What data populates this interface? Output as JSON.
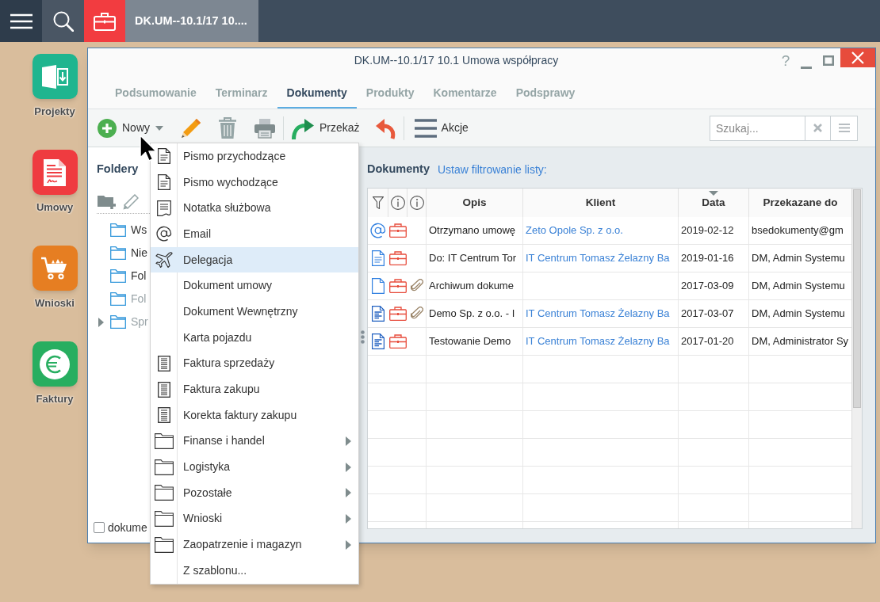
{
  "top_bar": {
    "tabs": [
      {
        "title": "DK.UM--10.1/17 10....",
        "selected": true
      }
    ]
  },
  "desktop_icons": [
    {
      "label": "Projekty",
      "kind": "project",
      "color": "#1fb58f"
    },
    {
      "label": "Umowy",
      "kind": "contract",
      "color": "#ef3b40"
    },
    {
      "label": "Wnioski",
      "kind": "cart",
      "color": "#e67e22"
    },
    {
      "label": "Faktury",
      "kind": "euro",
      "color": "#27ae60"
    }
  ],
  "window": {
    "title": "DK.UM--10.1/17 10.1 Umowa współpracy",
    "help": "?",
    "tabs": [
      {
        "label": "Podsumowanie",
        "selected": false
      },
      {
        "label": "Terminarz",
        "selected": false
      },
      {
        "label": "Dokumenty",
        "selected": true
      },
      {
        "label": "Produkty",
        "selected": false
      },
      {
        "label": "Komentarze",
        "selected": false
      },
      {
        "label": "Podsprawy",
        "selected": false
      }
    ],
    "toolbar": {
      "groups": [
        {
          "buttons": [
            {
              "kind": "new",
              "label": "Nowy"
            },
            {
              "kind": "edit"
            },
            {
              "kind": "delete"
            },
            {
              "kind": "print"
            }
          ]
        },
        {
          "buttons": [
            {
              "kind": "forward",
              "label": "Przekaż"
            },
            {
              "kind": "undo"
            }
          ]
        },
        {
          "buttons": [
            {
              "kind": "actions",
              "label": "Akcje"
            }
          ]
        }
      ]
    },
    "search": {
      "placeholder": "Szukaj..."
    },
    "folders": {
      "title": "Foldery",
      "tree": [
        {
          "label": "Ws",
          "muted": false,
          "collapsed": false
        },
        {
          "label": "Nie",
          "muted": false,
          "collapsed": false
        },
        {
          "label": "Fol",
          "muted": false,
          "collapsed": false
        },
        {
          "label": "Fol",
          "muted": true,
          "collapsed": false
        },
        {
          "label": "Spr",
          "muted": true,
          "collapsed": true
        }
      ],
      "checkbox": {
        "label": "dokume",
        "checked": false
      }
    },
    "documents": {
      "title": "Dokumenty",
      "filter_link": "Ustaw filtrowanie listy:",
      "columns": [
        {
          "kind": "filter",
          "sorted": false
        },
        {
          "kind": "info",
          "sorted": false
        },
        {
          "kind": "info",
          "sorted": false
        },
        {
          "kind": "text",
          "label": "Opis",
          "sorted": false
        },
        {
          "kind": "text",
          "label": "Klient",
          "sorted": false
        },
        {
          "kind": "text",
          "label": "Data",
          "sorted": true
        },
        {
          "kind": "text",
          "label": "Przekazane do",
          "sorted": false
        }
      ],
      "rows": [
        {
          "kind": "email",
          "case": true,
          "attachment": false,
          "description": "Otrzymano umowę",
          "client": "Zeto Opole Sp. z o.o.",
          "date": "2019-02-12",
          "forwarded_to": "bsedokumenty@gm"
        },
        {
          "kind": "letter",
          "case": true,
          "attachment": false,
          "description": "Do: IT Centrum Tor",
          "client": "IT Centrum Tomasz Żelazny Ba",
          "date": "2019-01-16",
          "forwarded_to": "DM, Admin Systemu"
        },
        {
          "kind": "blank",
          "case": true,
          "attachment": true,
          "description": "Archiwum dokume",
          "date": "2017-03-09",
          "forwarded_to": "DM, Admin Systemu"
        },
        {
          "kind": "form",
          "case": true,
          "attachment": true,
          "description": "Demo Sp. z o.o. - I",
          "client": "IT Centrum Tomasz Żelazny Ba",
          "date": "2017-03-07",
          "forwarded_to": "DM, Admin Systemu"
        },
        {
          "kind": "form",
          "case": true,
          "attachment": false,
          "description": "Testowanie Demo",
          "client": "IT Centrum Tomasz Żelazny Ba",
          "date": "2017-01-20",
          "forwarded_to": "DM, Administrator Sy"
        }
      ]
    },
    "new_menu": {
      "items": [
        {
          "label": "Pismo przychodzące",
          "kind": "letter",
          "submenu": false,
          "selected": false
        },
        {
          "label": "Pismo wychodzące",
          "kind": "letter",
          "submenu": false,
          "selected": false
        },
        {
          "label": "Notatka służbowa",
          "kind": "note",
          "submenu": false,
          "selected": false
        },
        {
          "label": "Email",
          "kind": "email",
          "submenu": false,
          "selected": false
        },
        {
          "label": "Delegacja",
          "kind": "plane",
          "submenu": false,
          "selected": true
        },
        {
          "label": "Dokument umowy",
          "kind": "plain",
          "submenu": false,
          "selected": false
        },
        {
          "label": "Dokument Wewnętrzny",
          "kind": "plain",
          "submenu": false,
          "selected": false
        },
        {
          "label": "Karta pojazdu",
          "kind": "plain",
          "submenu": false,
          "selected": false
        },
        {
          "label": "Faktura sprzedaży",
          "kind": "invoice",
          "submenu": false,
          "selected": false
        },
        {
          "label": "Faktura zakupu",
          "kind": "invoice",
          "submenu": false,
          "selected": false
        },
        {
          "label": "Korekta faktury zakupu",
          "kind": "invoice",
          "submenu": false,
          "selected": false
        },
        {
          "label": "Finanse i handel",
          "kind": "folder",
          "submenu": true,
          "selected": false
        },
        {
          "label": "Logistyka",
          "kind": "folder",
          "submenu": true,
          "selected": false
        },
        {
          "label": "Pozostałe",
          "kind": "folder",
          "submenu": true,
          "selected": false
        },
        {
          "label": "Wnioski",
          "kind": "folder",
          "submenu": true,
          "selected": false
        },
        {
          "label": "Zaopatrzenie i magazyn",
          "kind": "folder",
          "submenu": true,
          "selected": false
        },
        {
          "label": "Z szablonu...",
          "kind": "plain",
          "submenu": false,
          "selected": false
        }
      ]
    }
  }
}
